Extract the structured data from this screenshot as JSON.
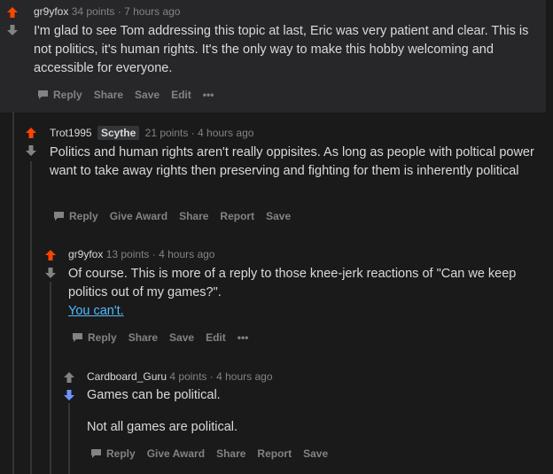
{
  "comments": [
    {
      "author": "gr9yfox",
      "flair": "",
      "points": "34 points",
      "time": "7 hours ago",
      "body": [
        "I'm glad to see Tom addressing this topic at last, Eric was very patient and clear. This is not politics, it's human rights. It's the only way to make this hobby welcoming and accessible for everyone."
      ],
      "actions": [
        "Reply",
        "Share",
        "Save",
        "Edit",
        "•••"
      ],
      "vote_state": "up"
    },
    {
      "author": "Trot1995",
      "flair": "Scythe",
      "points": "21 points",
      "time": "4 hours ago",
      "body": [
        "Politics and human rights aren't really oppisites. As long as people with poltical power want to take away rights then preserving and fighting for them is inherently political"
      ],
      "actions": [
        "Reply",
        "Give Award",
        "Share",
        "Report",
        "Save"
      ],
      "vote_state": "up"
    },
    {
      "author": "gr9yfox",
      "flair": "",
      "points": "13 points",
      "time": "4 hours ago",
      "body": [
        "Of course. This is more of a reply to those knee-jerk reactions of \"Can we keep politics out of my games?\"."
      ],
      "link": "You can't.",
      "actions": [
        "Reply",
        "Share",
        "Save",
        "Edit",
        "•••"
      ],
      "vote_state": "up"
    },
    {
      "author": "Cardboard_Guru",
      "flair": "",
      "points": "4 points",
      "time": "4 hours ago",
      "body": [
        "Games can be political.",
        "Not all games are political."
      ],
      "actions": [
        "Reply",
        "Give Award",
        "Share",
        "Report",
        "Save"
      ],
      "vote_state": "down"
    }
  ],
  "colors": {
    "upvote": "#ff4500",
    "downvote": "#7193ff",
    "neutral": "#818384"
  }
}
